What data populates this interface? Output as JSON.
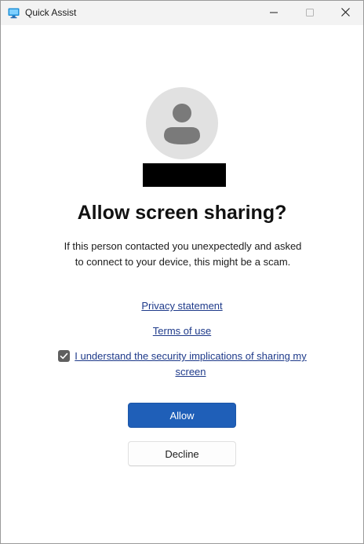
{
  "window": {
    "title": "Quick Assist",
    "app_icon": "quick-assist-monitor-icon",
    "controls": {
      "minimize_icon": "minimize-icon",
      "maximize_icon": "maximize-icon",
      "close_icon": "close-icon"
    }
  },
  "prompt": {
    "avatar_icon": "person-icon",
    "heading": "Allow screen sharing?",
    "warning": "If this person contacted you unexpectedly and asked to connect to your device, this might be a scam.",
    "privacy_link": "Privacy statement",
    "terms_link": "Terms of use",
    "consent_checkbox": {
      "checked": true,
      "label": "I understand the security implications of sharing my screen"
    },
    "allow_button": "Allow",
    "decline_button": "Decline"
  },
  "colors": {
    "accent": "#1f5fb8",
    "link": "#1e3a8a",
    "titlebar": "#f3f3f3"
  }
}
